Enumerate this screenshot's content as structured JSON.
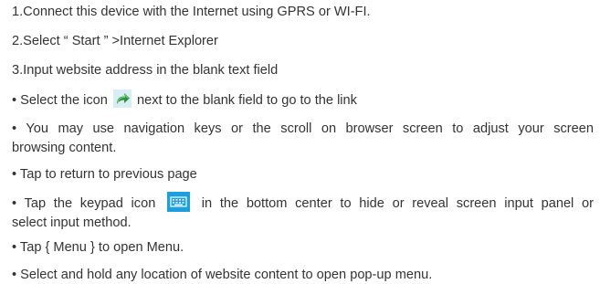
{
  "steps": {
    "s1": "1.Connect this device with the Internet using GPRS or WI-FI.",
    "s2": "2.Select “ Start ” >Internet Explorer",
    "s3": "3.Input website address in the blank text field"
  },
  "bullets": {
    "b1_before": " • Select the icon ",
    "b1_after": " next to the blank field to go to the link",
    "b2_line1": " • You may use navigation keys or the scroll on browser screen to adjust your screen",
    "b2_line2": "browsing content.",
    "b3": " • Tap to return to previous page",
    "b4_before": " • Tap the keypad icon ",
    "b4_after": " in the bottom center to hide or reveal screen input panel or",
    "b4_line2": "select input method.",
    "b5": " • Tap { Menu } to open Menu.",
    "b6": " • Select and hold any location of website content to open pop-up menu."
  },
  "icons": {
    "go": "go-arrow-icon",
    "keypad": "keypad-icon"
  },
  "colors": {
    "text": "#333333",
    "go_bg": "#d8eef5",
    "go_arrow": "#2f8f3a",
    "keypad_bg": "#1aa0e0"
  }
}
